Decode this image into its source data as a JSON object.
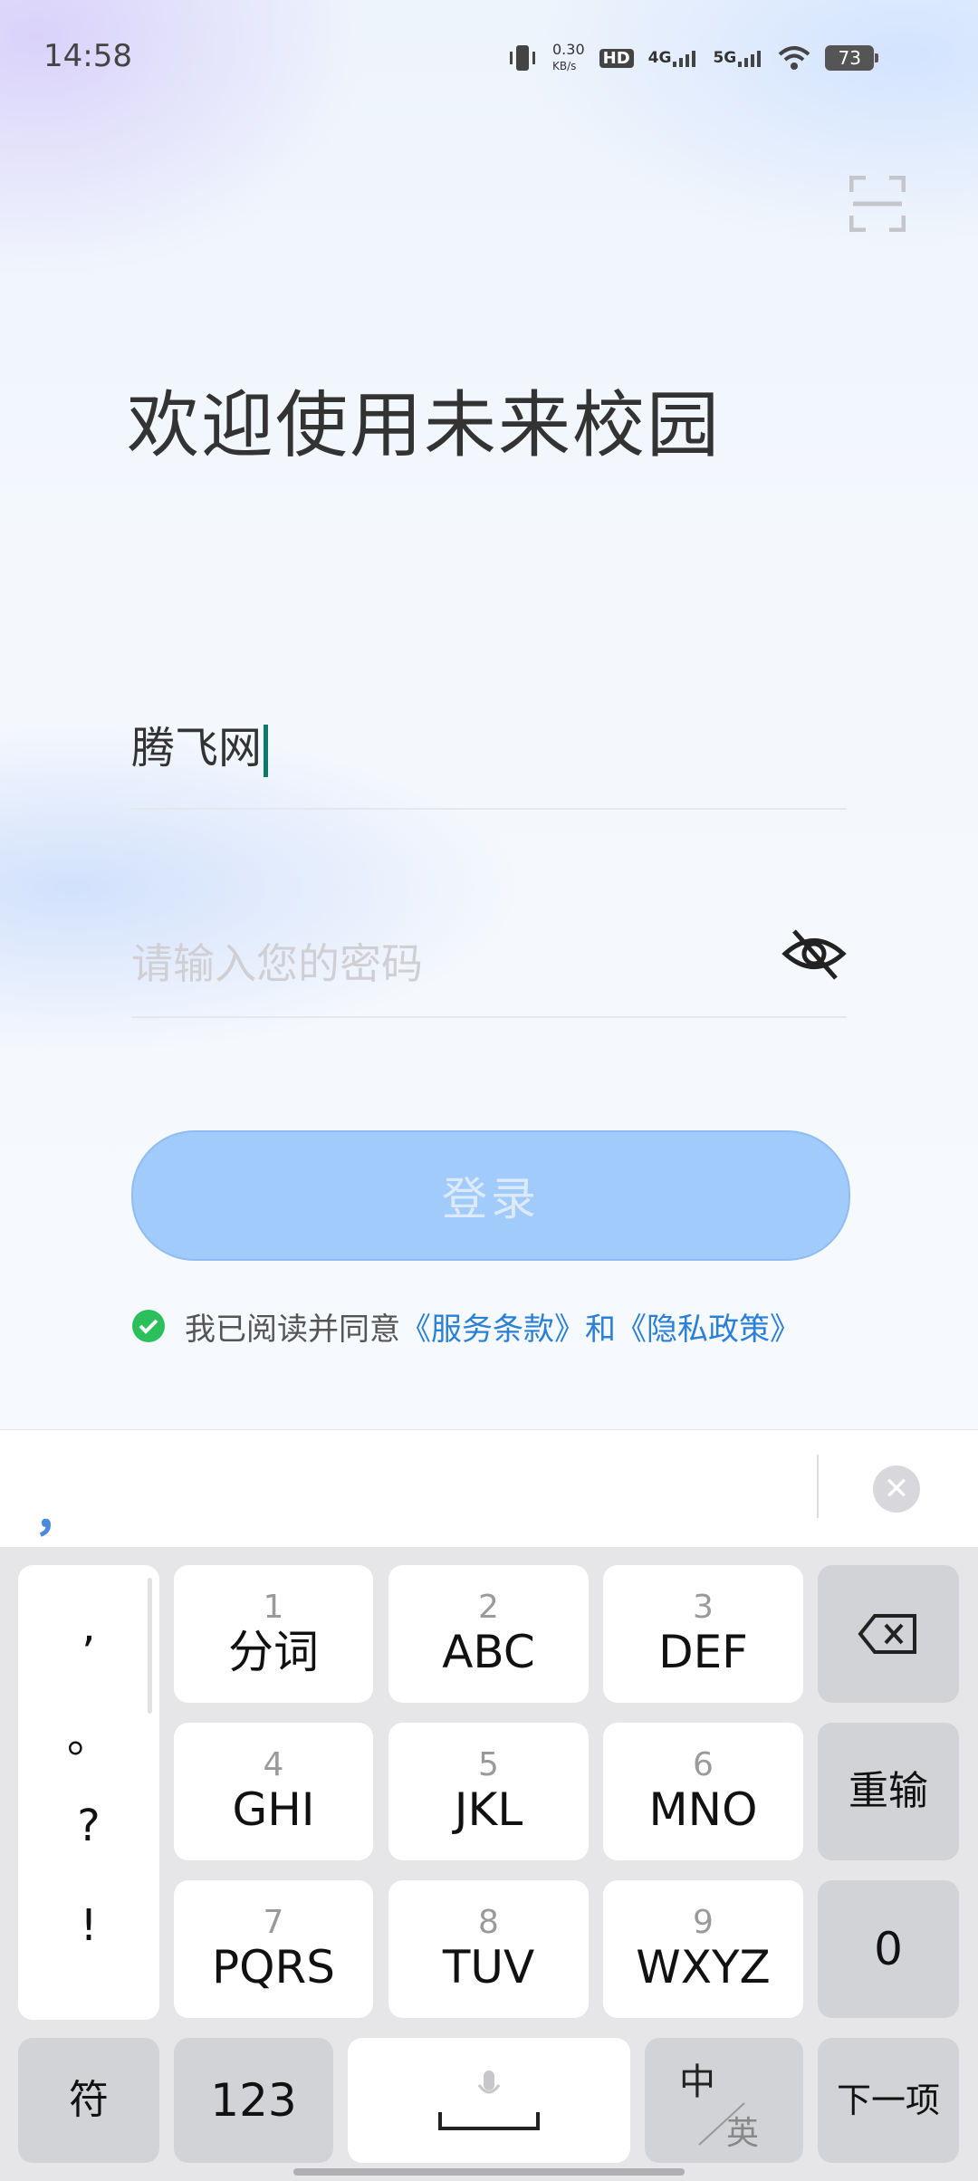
{
  "status_bar": {
    "time": "14:58",
    "net_speed_value": "0.30",
    "net_speed_unit": "KB/s",
    "hd_label": "HD",
    "sim1_label": "4G",
    "sim2_label": "5G",
    "battery": "73"
  },
  "header": {
    "title": "欢迎使用未来校园"
  },
  "form": {
    "username_value": "腾飞网",
    "password_placeholder": "请输入您的密码",
    "login_label": "登录"
  },
  "agreement": {
    "prefix": "我已阅读并同意",
    "terms_link": "《服务条款》",
    "conj": "和",
    "privacy_link": "《隐私政策》"
  },
  "keyboard": {
    "candidate": "，",
    "punct": [
      ",",
      "。",
      "?",
      "!"
    ],
    "keys": [
      {
        "num": "1",
        "label": "分词"
      },
      {
        "num": "2",
        "label": "ABC"
      },
      {
        "num": "3",
        "label": "DEF"
      },
      {
        "num": "4",
        "label": "GHI"
      },
      {
        "num": "5",
        "label": "JKL"
      },
      {
        "num": "6",
        "label": "MNO"
      },
      {
        "num": "7",
        "label": "PQRS"
      },
      {
        "num": "8",
        "label": "TUV"
      },
      {
        "num": "9",
        "label": "WXYZ"
      }
    ],
    "retype": "重输",
    "zero": "0",
    "symbols": "符",
    "numeric": "123",
    "lang_cn": "中",
    "lang_en": "英",
    "next": "下一项"
  },
  "colors": {
    "accent": "#2a7fd6",
    "login_button": "#a1cbfb",
    "check": "#2cc05d"
  }
}
